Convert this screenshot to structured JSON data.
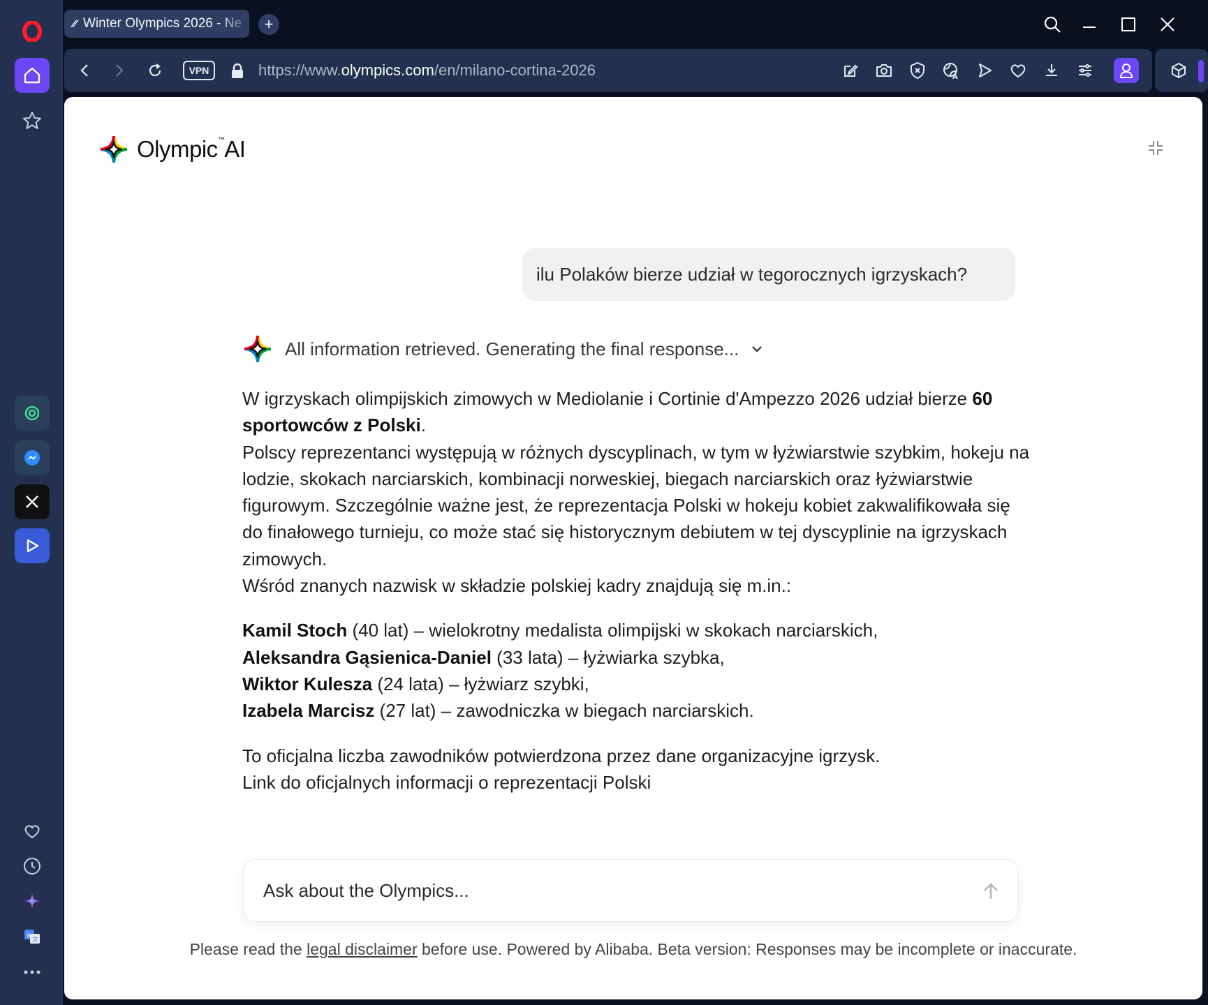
{
  "browser": {
    "tab": {
      "title": "Winter Olympics 2026 - Ne",
      "favicon": "olympics-favicon"
    },
    "new_tab_label": "+",
    "vpn_label": "VPN",
    "url": {
      "prefix": "https://www.",
      "domain": "olympics.com",
      "path": "/en/milano-cortina-2026"
    },
    "toolbar_icons": [
      "snapshot-edit-icon",
      "camera-icon",
      "ad-block-icon",
      "translate-globe-icon",
      "send-play-icon",
      "heart-icon",
      "download-icon",
      "easy-setup-icon",
      "profile-icon"
    ],
    "accent_color": "#6b47f5"
  },
  "sidebar": {
    "apps": [
      "chatgpt-icon",
      "messenger-icon",
      "x-icon",
      "aria-icon"
    ],
    "bottom": [
      "heart-icon",
      "history-clock-icon",
      "ai-spark-icon",
      "translate-icon",
      "more-icon"
    ]
  },
  "page": {
    "brand": {
      "name": "Olympic",
      "suffix": "AI",
      "mark": "™"
    },
    "user_message": "ilu Polaków bierze udział w tegorocznych igrzyskach?",
    "status": "All information retrieved. Generating the final response...",
    "answer": {
      "p1_a": "W igrzyskach olimpijskich zimowych w Mediolanie i Cortinie d'Ampezzo 2026 udział bierze ",
      "p1_bold": "60 sportowców z Polski",
      "p1_b": ".",
      "p2": "Polscy reprezentanci występują w różnych dyscyplinach, w tym w łyżwiarstwie szybkim, hokeju na lodzie, skokach narciarskich, kombinacji norweskiej, biegach narciarskich oraz łyżwiarstwie figurowym. Szczególnie ważne jest, że reprezentacja Polski w hokeju kobiet zakwalifikowała się do finałowego turnieju, co może stać się historycznym debiutem w tej dyscyplinie na igrzyskach zimowych.",
      "p3": "Wśród znanych nazwisk w składzie polskiej kadry znajdują się m.in.:",
      "athletes": [
        {
          "name": "Kamil Stoch",
          "desc": " (40 lat) – wielokrotny medalista olimpijski w skokach narciarskich,"
        },
        {
          "name": "Aleksandra Gąsienica-Daniel",
          "desc": " (33 lata) – łyżwiarka szybka,"
        },
        {
          "name": "Wiktor Kulesza",
          "desc": " (24 lata) – łyżwiarz szybki,"
        },
        {
          "name": "Izabela Marcisz",
          "desc": " (27 lat) – zawodniczka w biegach narciarskich."
        }
      ],
      "p4": "To oficjalna liczba zawodników potwierdzona przez dane organizacyjne igrzysk.",
      "p5": "Link do oficjalnych informacji o reprezentacji Polski"
    },
    "ask_placeholder": "Ask about the Olympics...",
    "disclaimer": {
      "before": "Please read the ",
      "link": "legal disclaimer",
      "after": " before use. Powered by Alibaba. Beta version: Responses may be incomplete or inaccurate."
    }
  }
}
